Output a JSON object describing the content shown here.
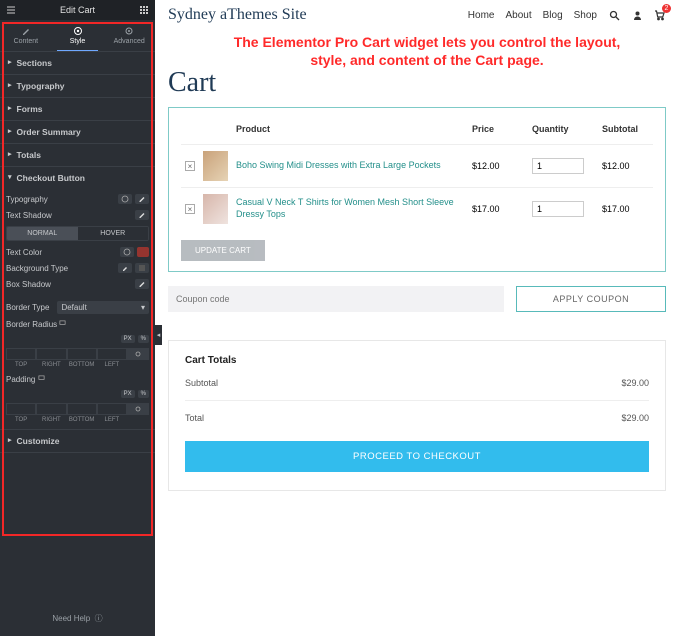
{
  "sidebar": {
    "header": "Edit Cart",
    "tabs": {
      "content": "Content",
      "style": "Style",
      "advanced": "Advanced"
    },
    "sections": [
      "Sections",
      "Typography",
      "Forms",
      "Order Summary",
      "Totals",
      "Checkout Button"
    ],
    "checkout": {
      "typography": "Typography",
      "text_shadow": "Text Shadow",
      "normal": "NORMAL",
      "hover": "HOVER",
      "text_color": "Text Color",
      "bg_type": "Background Type",
      "box_shadow": "Box Shadow",
      "border_type": "Border Type",
      "border_type_val": "Default",
      "border_radius": "Border Radius",
      "padding": "Padding",
      "units": "PX %",
      "dim_top": "TOP",
      "dim_right": "RIGHT",
      "dim_bottom": "BOTTOM",
      "dim_left": "LEFT"
    },
    "customize": "Customize",
    "help": "Need Help"
  },
  "header": {
    "brand": "Sydney aThemes Site",
    "nav": [
      "Home",
      "About",
      "Blog",
      "Shop"
    ],
    "cart_count": "2"
  },
  "annotation": "The Elementor Pro Cart widget lets you control the layout, style, and content of the Cart page.",
  "page": {
    "title": "Cart"
  },
  "cart": {
    "cols": {
      "product": "Product",
      "price": "Price",
      "quantity": "Quantity",
      "subtotal": "Subtotal"
    },
    "items": [
      {
        "name": "Boho Swing Midi Dresses with Extra Large Pockets",
        "price": "$12.00",
        "qty": "1",
        "subtotal": "$12.00"
      },
      {
        "name": "Casual V Neck T Shirts for Women Mesh Short Sleeve Dressy Tops",
        "price": "$17.00",
        "qty": "1",
        "subtotal": "$17.00"
      }
    ],
    "update": "UPDATE CART"
  },
  "coupon": {
    "placeholder": "Coupon code",
    "apply": "APPLY COUPON"
  },
  "totals": {
    "heading": "Cart Totals",
    "subtotal_label": "Subtotal",
    "subtotal": "$29.00",
    "total_label": "Total",
    "total": "$29.00",
    "checkout": "PROCEED TO CHECKOUT"
  }
}
